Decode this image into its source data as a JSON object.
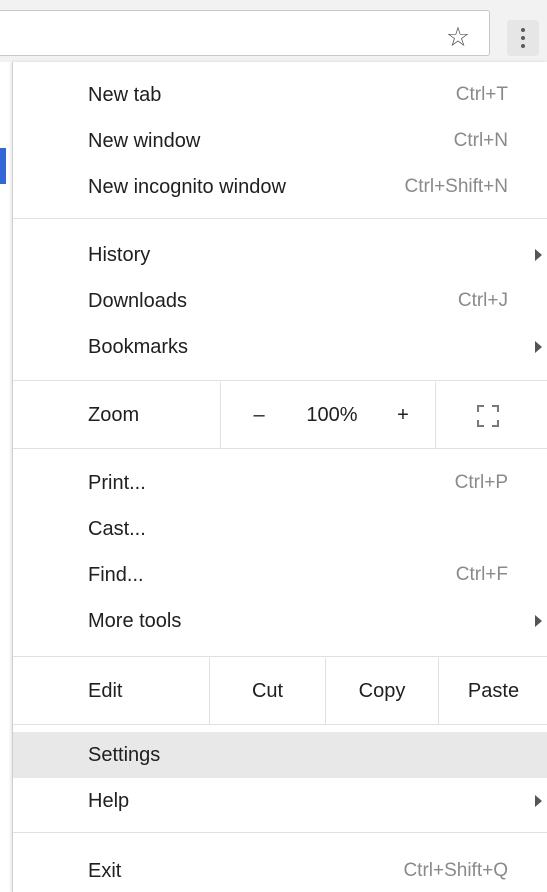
{
  "toolbar": {
    "star_icon": "star-outline-icon",
    "menu_icon": "vertical-ellipsis-icon"
  },
  "menu": {
    "group1": [
      {
        "label": "New tab",
        "shortcut": "Ctrl+T"
      },
      {
        "label": "New window",
        "shortcut": "Ctrl+N"
      },
      {
        "label": "New incognito window",
        "shortcut": "Ctrl+Shift+N"
      }
    ],
    "group2": [
      {
        "label": "History",
        "submenu": true
      },
      {
        "label": "Downloads",
        "shortcut": "Ctrl+J"
      },
      {
        "label": "Bookmarks",
        "submenu": true
      }
    ],
    "zoom": {
      "label": "Zoom",
      "minus": "–",
      "level": "100%",
      "plus": "+"
    },
    "group3": [
      {
        "label": "Print...",
        "shortcut": "Ctrl+P"
      },
      {
        "label": "Cast..."
      },
      {
        "label": "Find...",
        "shortcut": "Ctrl+F"
      },
      {
        "label": "More tools",
        "submenu": true
      }
    ],
    "edit": {
      "label": "Edit",
      "cut": "Cut",
      "copy": "Copy",
      "paste": "Paste"
    },
    "group4": [
      {
        "label": "Settings",
        "highlighted": true
      },
      {
        "label": "Help",
        "submenu": true
      }
    ],
    "exit": {
      "label": "Exit",
      "shortcut": "Ctrl+Shift+Q"
    }
  },
  "colors": {
    "highlight": "#e8e8e8",
    "accent": "#3367d6"
  }
}
